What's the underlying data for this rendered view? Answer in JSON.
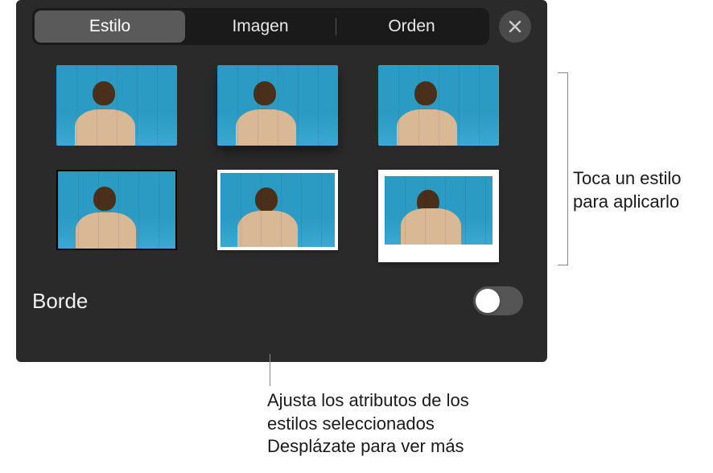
{
  "tabs": {
    "style": "Estilo",
    "image": "Imagen",
    "order": "Orden"
  },
  "styles": [
    {
      "id": "plain"
    },
    {
      "id": "shadow"
    },
    {
      "id": "soft"
    },
    {
      "id": "black-border"
    },
    {
      "id": "white-border"
    },
    {
      "id": "polaroid"
    }
  ],
  "border": {
    "label": "Borde",
    "enabled": false
  },
  "callouts": {
    "right": "Toca un estilo para aplicarlo",
    "bottom": "Ajusta los atributos de los estilos seleccionados Desplázate para ver más"
  },
  "colors": {
    "panel_bg": "#2a2a2a",
    "tab_active": "#5a5a5a",
    "thumb_bg": "#2b9bc4"
  }
}
